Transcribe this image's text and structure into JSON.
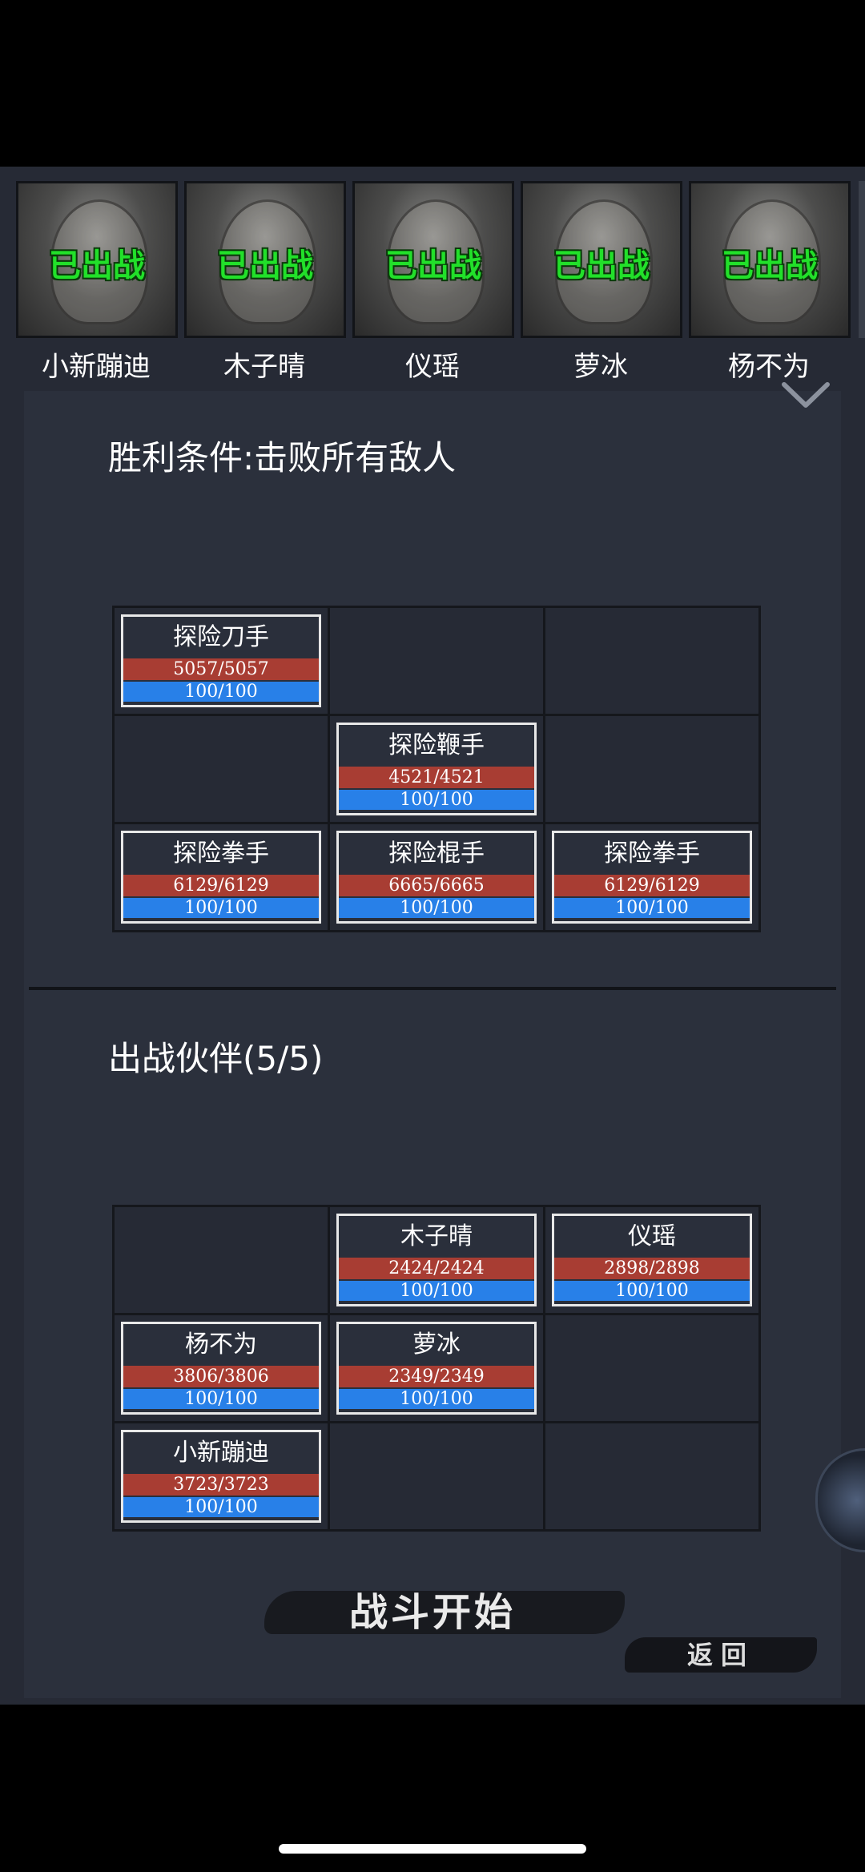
{
  "roster": [
    {
      "name": "小新蹦迪",
      "status": "已出战"
    },
    {
      "name": "木子晴",
      "status": "已出战"
    },
    {
      "name": "仪瑶",
      "status": "已出战"
    },
    {
      "name": "萝冰",
      "status": "已出战"
    },
    {
      "name": "杨不为",
      "status": "已出战"
    }
  ],
  "enemy_section": {
    "title": "胜利条件:击败所有敌人",
    "units": [
      {
        "name": "探险刀手",
        "hp": "5057/5057",
        "mp": "100/100"
      },
      {
        "name": "探险鞭手",
        "hp": "4521/4521",
        "mp": "100/100"
      },
      {
        "name": "探险拳手",
        "hp": "6129/6129",
        "mp": "100/100"
      },
      {
        "name": "探险棍手",
        "hp": "6665/6665",
        "mp": "100/100"
      },
      {
        "name": "探险拳手",
        "hp": "6129/6129",
        "mp": "100/100"
      }
    ]
  },
  "ally_section": {
    "title": "出战伙伴(5/5)",
    "units": [
      {
        "name": "木子晴",
        "hp": "2424/2424",
        "mp": "100/100"
      },
      {
        "name": "仪瑶",
        "hp": "2898/2898",
        "mp": "100/100"
      },
      {
        "name": "杨不为",
        "hp": "3806/3806",
        "mp": "100/100"
      },
      {
        "name": "萝冰",
        "hp": "2349/2349",
        "mp": "100/100"
      },
      {
        "name": "小新蹦迪",
        "hp": "3723/3723",
        "mp": "100/100"
      }
    ]
  },
  "buttons": {
    "start": "战斗开始",
    "back": "返回"
  },
  "colors": {
    "status_green": "#22e02a",
    "hp_red": "#a83d33",
    "mp_blue": "#2880e8",
    "panel_bg": "#2b303c"
  }
}
